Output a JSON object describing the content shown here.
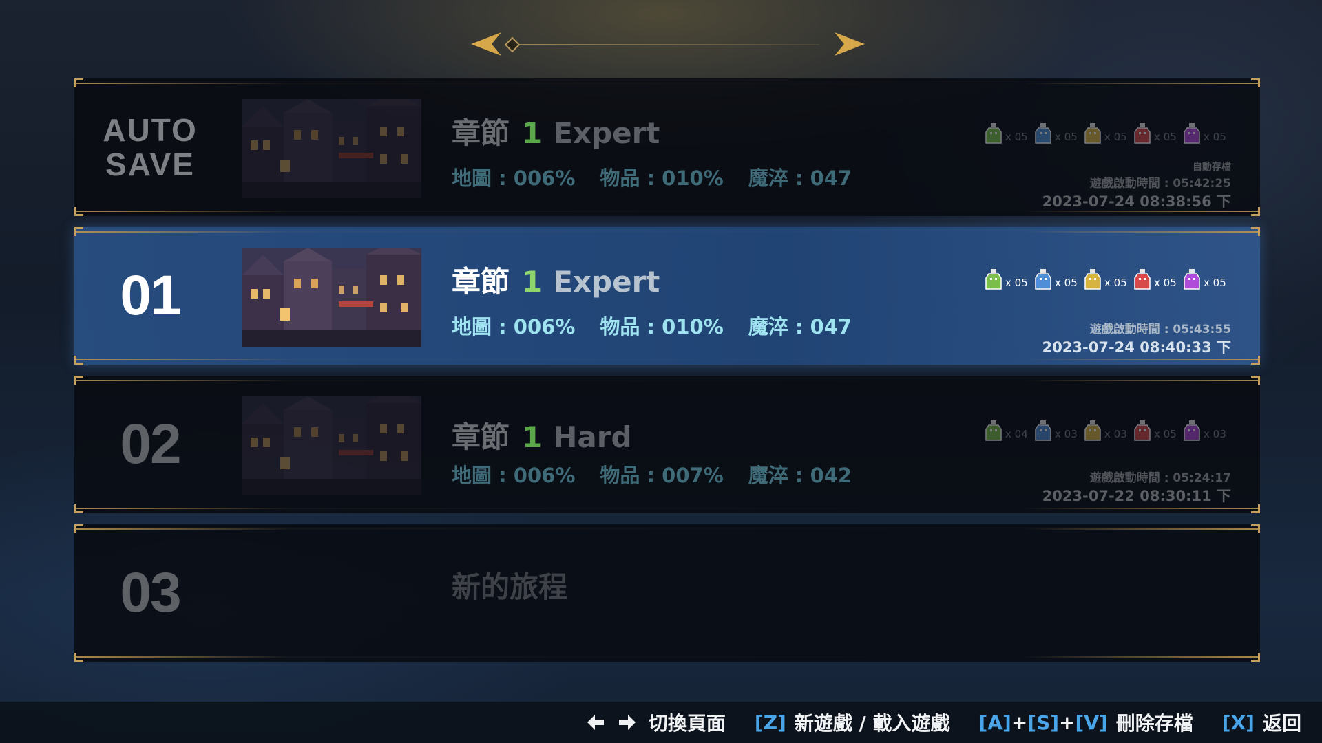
{
  "slots": [
    {
      "id": "AUTO\nSAVE",
      "chapter_label": "章節",
      "chapter_num": "1",
      "difficulty": "Expert",
      "map": "地圖 : 006%",
      "items": "物品 : 010%",
      "essence": "魔淬 : 047",
      "potions": [
        "x 05",
        "x 05",
        "x 05",
        "x 05",
        "x 05"
      ],
      "auto_label": "自動存檔",
      "playtime": "遊戲啟動時間 : 05:42:25",
      "date": "2023-07-24 08:38:56 下"
    },
    {
      "id": "01",
      "chapter_label": "章節",
      "chapter_num": "1",
      "difficulty": "Expert",
      "map": "地圖 : 006%",
      "items": "物品 : 010%",
      "essence": "魔淬 : 047",
      "potions": [
        "x 05",
        "x 05",
        "x 05",
        "x 05",
        "x 05"
      ],
      "playtime": "遊戲啟動時間 : 05:43:55",
      "date": "2023-07-24 08:40:33 下"
    },
    {
      "id": "02",
      "chapter_label": "章節",
      "chapter_num": "1",
      "difficulty": "Hard",
      "map": "地圖 : 006%",
      "items": "物品 : 007%",
      "essence": "魔淬 : 042",
      "potions": [
        "x 04",
        "x 03",
        "x 03",
        "x 05",
        "x 03"
      ],
      "playtime": "遊戲啟動時間 : 05:24:17",
      "date": "2023-07-22 08:30:11 下"
    },
    {
      "id": "03",
      "new_label": "新的旅程"
    }
  ],
  "potion_colors": [
    "#7bbf4a",
    "#4f8fd8",
    "#d7b340",
    "#d84a4a",
    "#b04ad8"
  ],
  "controls": {
    "switch_page": "切換頁面",
    "key_z": "[Z]",
    "new_load": "新遊戲 / 載入遊戲",
    "key_a": "[A]",
    "plus1": "+",
    "key_s": "[S]",
    "plus2": "+",
    "key_v": "[V]",
    "delete": "刪除存檔",
    "key_x": "[X]",
    "back": "返回"
  }
}
